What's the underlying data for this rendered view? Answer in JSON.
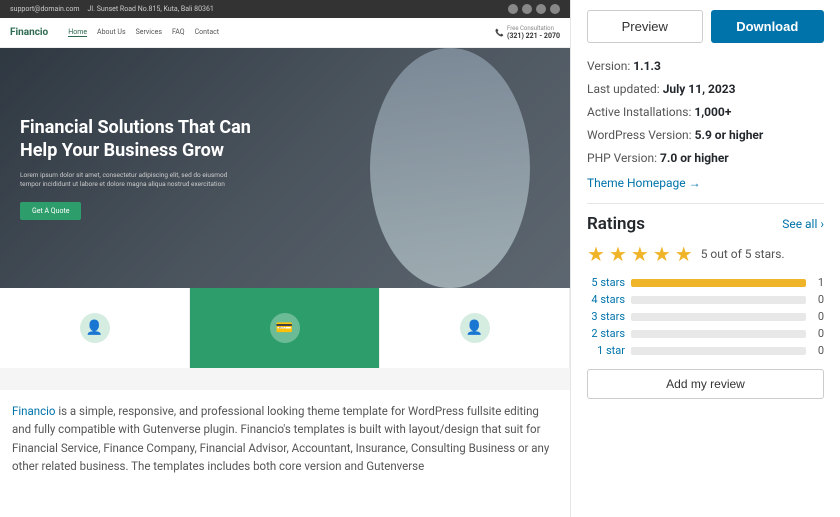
{
  "left": {
    "topbar": {
      "email": "support@domain.com",
      "address": "Jl. Sunset Road No.815, Kuta, Bali 80361"
    },
    "navbar": {
      "logo": "Financio",
      "links": [
        "Home",
        "About Us",
        "Services",
        "FAQ",
        "Contact"
      ],
      "active_link": "Home",
      "phone_label": "Free Consultation",
      "phone_number": "(321) 221 - 2070"
    },
    "hero": {
      "title": "Financial Solutions That Can Help Your Business Grow",
      "description": "Lorem ipsum dolor sit amet, consectetur adipiscing elit, sed do eiusmod tempor incididunt ut labore et dolore magna aliqua nostrud exercitation",
      "button_label": "Get A Quote"
    },
    "cards": [
      {
        "icon": "👤"
      },
      {
        "icon": "💳"
      },
      {
        "icon": "👤"
      }
    ],
    "description": "Financio is a simple, responsive, and professional looking theme template for WordPress fullsite editing and fully compatible with Gutenverse plugin. Financio's templates is built with layout/design that suit for Financial Service, Finance Company, Financial Advisor, Accountant, Insurance, Consulting Business or any other related business. The templates includes both core version and Gutenverse"
  },
  "right": {
    "buttons": {
      "preview_label": "Preview",
      "download_label": "Download"
    },
    "meta": {
      "version_label": "Version:",
      "version_value": "1.1.3",
      "last_updated_label": "Last updated:",
      "last_updated_value": "July 11, 2023",
      "active_installs_label": "Active Installations:",
      "active_installs_value": "1,000+",
      "wp_version_label": "WordPress Version:",
      "wp_version_value": "5.9 or higher",
      "php_version_label": "PHP Version:",
      "php_version_value": "7.0 or higher",
      "theme_homepage_label": "Theme Homepage →"
    },
    "ratings": {
      "section_title": "Ratings",
      "see_all_label": "See all",
      "see_all_arrow": "›",
      "stars_count": 5,
      "stars_label": "5 out of 5 stars.",
      "bars": [
        {
          "label": "5 stars",
          "fill_percent": 100,
          "count": 1
        },
        {
          "label": "4 stars",
          "fill_percent": 0,
          "count": 0
        },
        {
          "label": "3 stars",
          "fill_percent": 0,
          "count": 0
        },
        {
          "label": "2 stars",
          "fill_percent": 0,
          "count": 0
        },
        {
          "label": "1 star",
          "fill_percent": 0,
          "count": 0
        }
      ],
      "add_review_label": "Add my review"
    }
  }
}
